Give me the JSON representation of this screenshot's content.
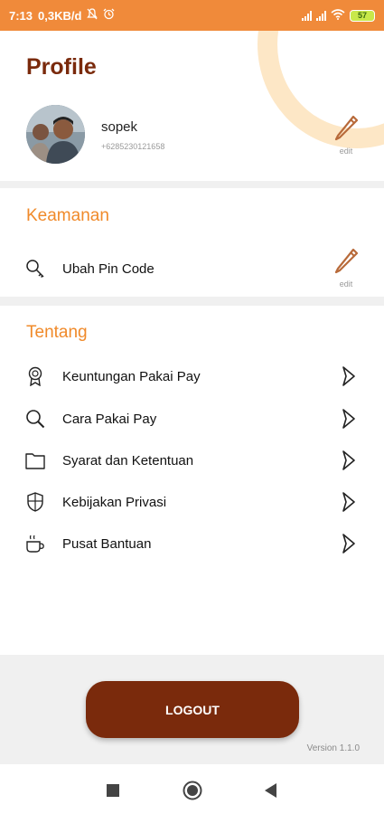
{
  "status_bar": {
    "time": "7:13",
    "speed": "0,3KB/d",
    "battery": "57"
  },
  "profile": {
    "title": "Profile",
    "name": "sopek",
    "phone": "+6285230121658",
    "edit_label": "edit"
  },
  "security": {
    "title": "Keamanan",
    "item_label": "Ubah Pin Code",
    "edit_label": "edit"
  },
  "about": {
    "title": "Tentang",
    "items": [
      {
        "label": "Keuntungan Pakai Pay",
        "icon": "badge-icon"
      },
      {
        "label": "Cara Pakai Pay",
        "icon": "search-icon"
      },
      {
        "label": "Syarat dan Ketentuan",
        "icon": "folder-icon"
      },
      {
        "label": "Kebijakan Privasi",
        "icon": "shield-icon"
      },
      {
        "label": "Pusat Bantuan",
        "icon": "coffee-cup-icon"
      }
    ]
  },
  "logout_label": "LOGOUT",
  "version": "Version  1.1.0",
  "colors": {
    "primary": "#7a2a0c",
    "accent": "#f08a2a",
    "status_bar": "#f08a3a"
  }
}
